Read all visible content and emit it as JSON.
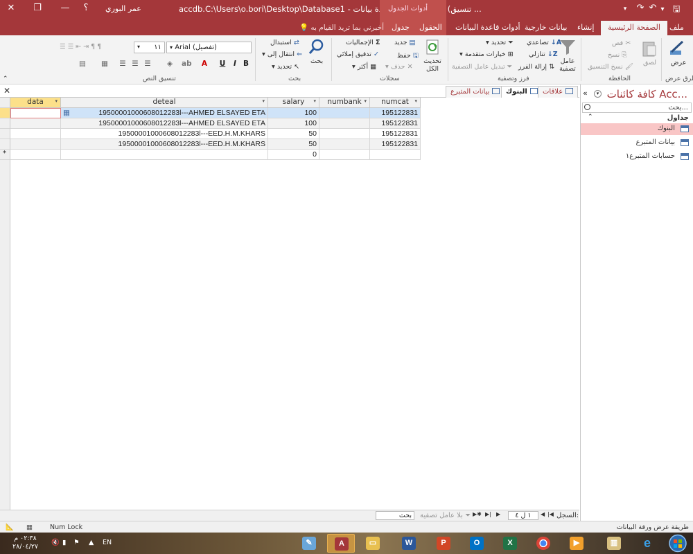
{
  "window": {
    "title": "accdb.C:\\Users\\o.bori\\Desktop\\Database1 - قاعدة بيانات : Database1 (تنسيق ...",
    "context_group": "أدوات الجدول",
    "user": "عمر البوري",
    "help": "؟"
  },
  "tabs": [
    {
      "label": "ملف"
    },
    {
      "label": "الصفحة الرئيسية"
    },
    {
      "label": "إنشاء"
    },
    {
      "label": "بيانات خارجية"
    },
    {
      "label": "أدوات قاعدة البيانات"
    },
    {
      "label": "الحقول"
    },
    {
      "label": "جدول"
    }
  ],
  "tell_me": "أخبرني بما تريد القيام به",
  "ribbon": {
    "views": {
      "view": "عرض",
      "group": "طرق عرض"
    },
    "clipboard": {
      "paste": "لصق",
      "cut": "قص",
      "copy": "نسخ",
      "format_painter": "نسخ التنسيق",
      "group": "الحافظة"
    },
    "sort_filter": {
      "filter": "عامل تصفية",
      "ascending": "تصاعدي",
      "descending": "تنازلي",
      "remove_sort": "إزالة الفرز",
      "selection": "تحديد",
      "advanced": "خيارات متقدمة",
      "toggle": "تبديل عامل التصفية",
      "group": "فرز وتصفية"
    },
    "records": {
      "refresh": "تحديث",
      "refresh_all": "الكل",
      "new": "جديد",
      "save": "حفظ",
      "delete": "حذف",
      "totals": "الإجماليات",
      "spelling": "تدقيق إملائي",
      "more": "أكثر",
      "group": "سجلات"
    },
    "find": {
      "find": "بحث",
      "replace": "استبدال",
      "goto": "انتقال إلى",
      "select": "تحديد",
      "group": "بحث"
    },
    "text_format": {
      "font": "Arial (تفصيل)",
      "size": "١١",
      "group": "تنسيق النص",
      "bold": "B",
      "italic": "I",
      "underline": "U"
    }
  },
  "object_tabs": [
    {
      "label": "علاقات",
      "active": false
    },
    {
      "label": "البنوك",
      "active": true
    },
    {
      "label": "بيانات المتبرع",
      "active": false
    }
  ],
  "table": {
    "columns": [
      {
        "label": "numcat"
      },
      {
        "label": "numbank"
      },
      {
        "label": "salary"
      },
      {
        "label": "deteal"
      },
      {
        "label": "data"
      }
    ],
    "rows": [
      {
        "numcat": "195122831",
        "numbank": "",
        "salary": "100",
        "deteal": "19500001000608012283l---AHMED ELSAYED ETA",
        "data": ""
      },
      {
        "numcat": "195122831",
        "numbank": "",
        "salary": "100",
        "deteal": "19500001000608012283l---AHMED ELSAYED ETA",
        "data": ""
      },
      {
        "numcat": "195122831",
        "numbank": "",
        "salary": "50",
        "deteal": "19500001000608012283l---EED.H.M.KHARS",
        "data": ""
      },
      {
        "numcat": "195122831",
        "numbank": "",
        "salary": "50",
        "deteal": "19500001000608012283l---EED.H.M.KHARS",
        "data": ""
      }
    ],
    "new_row": {
      "salary": "0"
    },
    "new_row_marker": "*"
  },
  "record_nav": {
    "label": "السجل:",
    "position": "١ ل ٤",
    "filter": "بلا عامل تصفية",
    "search": "بحث"
  },
  "nav_pane": {
    "title": "كافة كائنات Acc...",
    "search_placeholder": "بحث...",
    "section": "جداول",
    "items": [
      {
        "label": "البنوك",
        "selected": true
      },
      {
        "label": "بيانات المتبرع",
        "selected": false
      },
      {
        "label": "حسابات المتبرع١",
        "selected": false
      }
    ]
  },
  "status": {
    "view_mode": "طريقة عرض ورقة البيانات",
    "num_lock": "Num Lock"
  },
  "taskbar": {
    "time": "٠٢:٣٨ م",
    "date": "٢٨/٠٤/٢٧",
    "lang": "EN"
  },
  "colors": {
    "brand": "#a4373a",
    "selected_row": "#cfe3f8",
    "header_active": "#fce08a",
    "nav_selected": "#f9c6c6"
  }
}
